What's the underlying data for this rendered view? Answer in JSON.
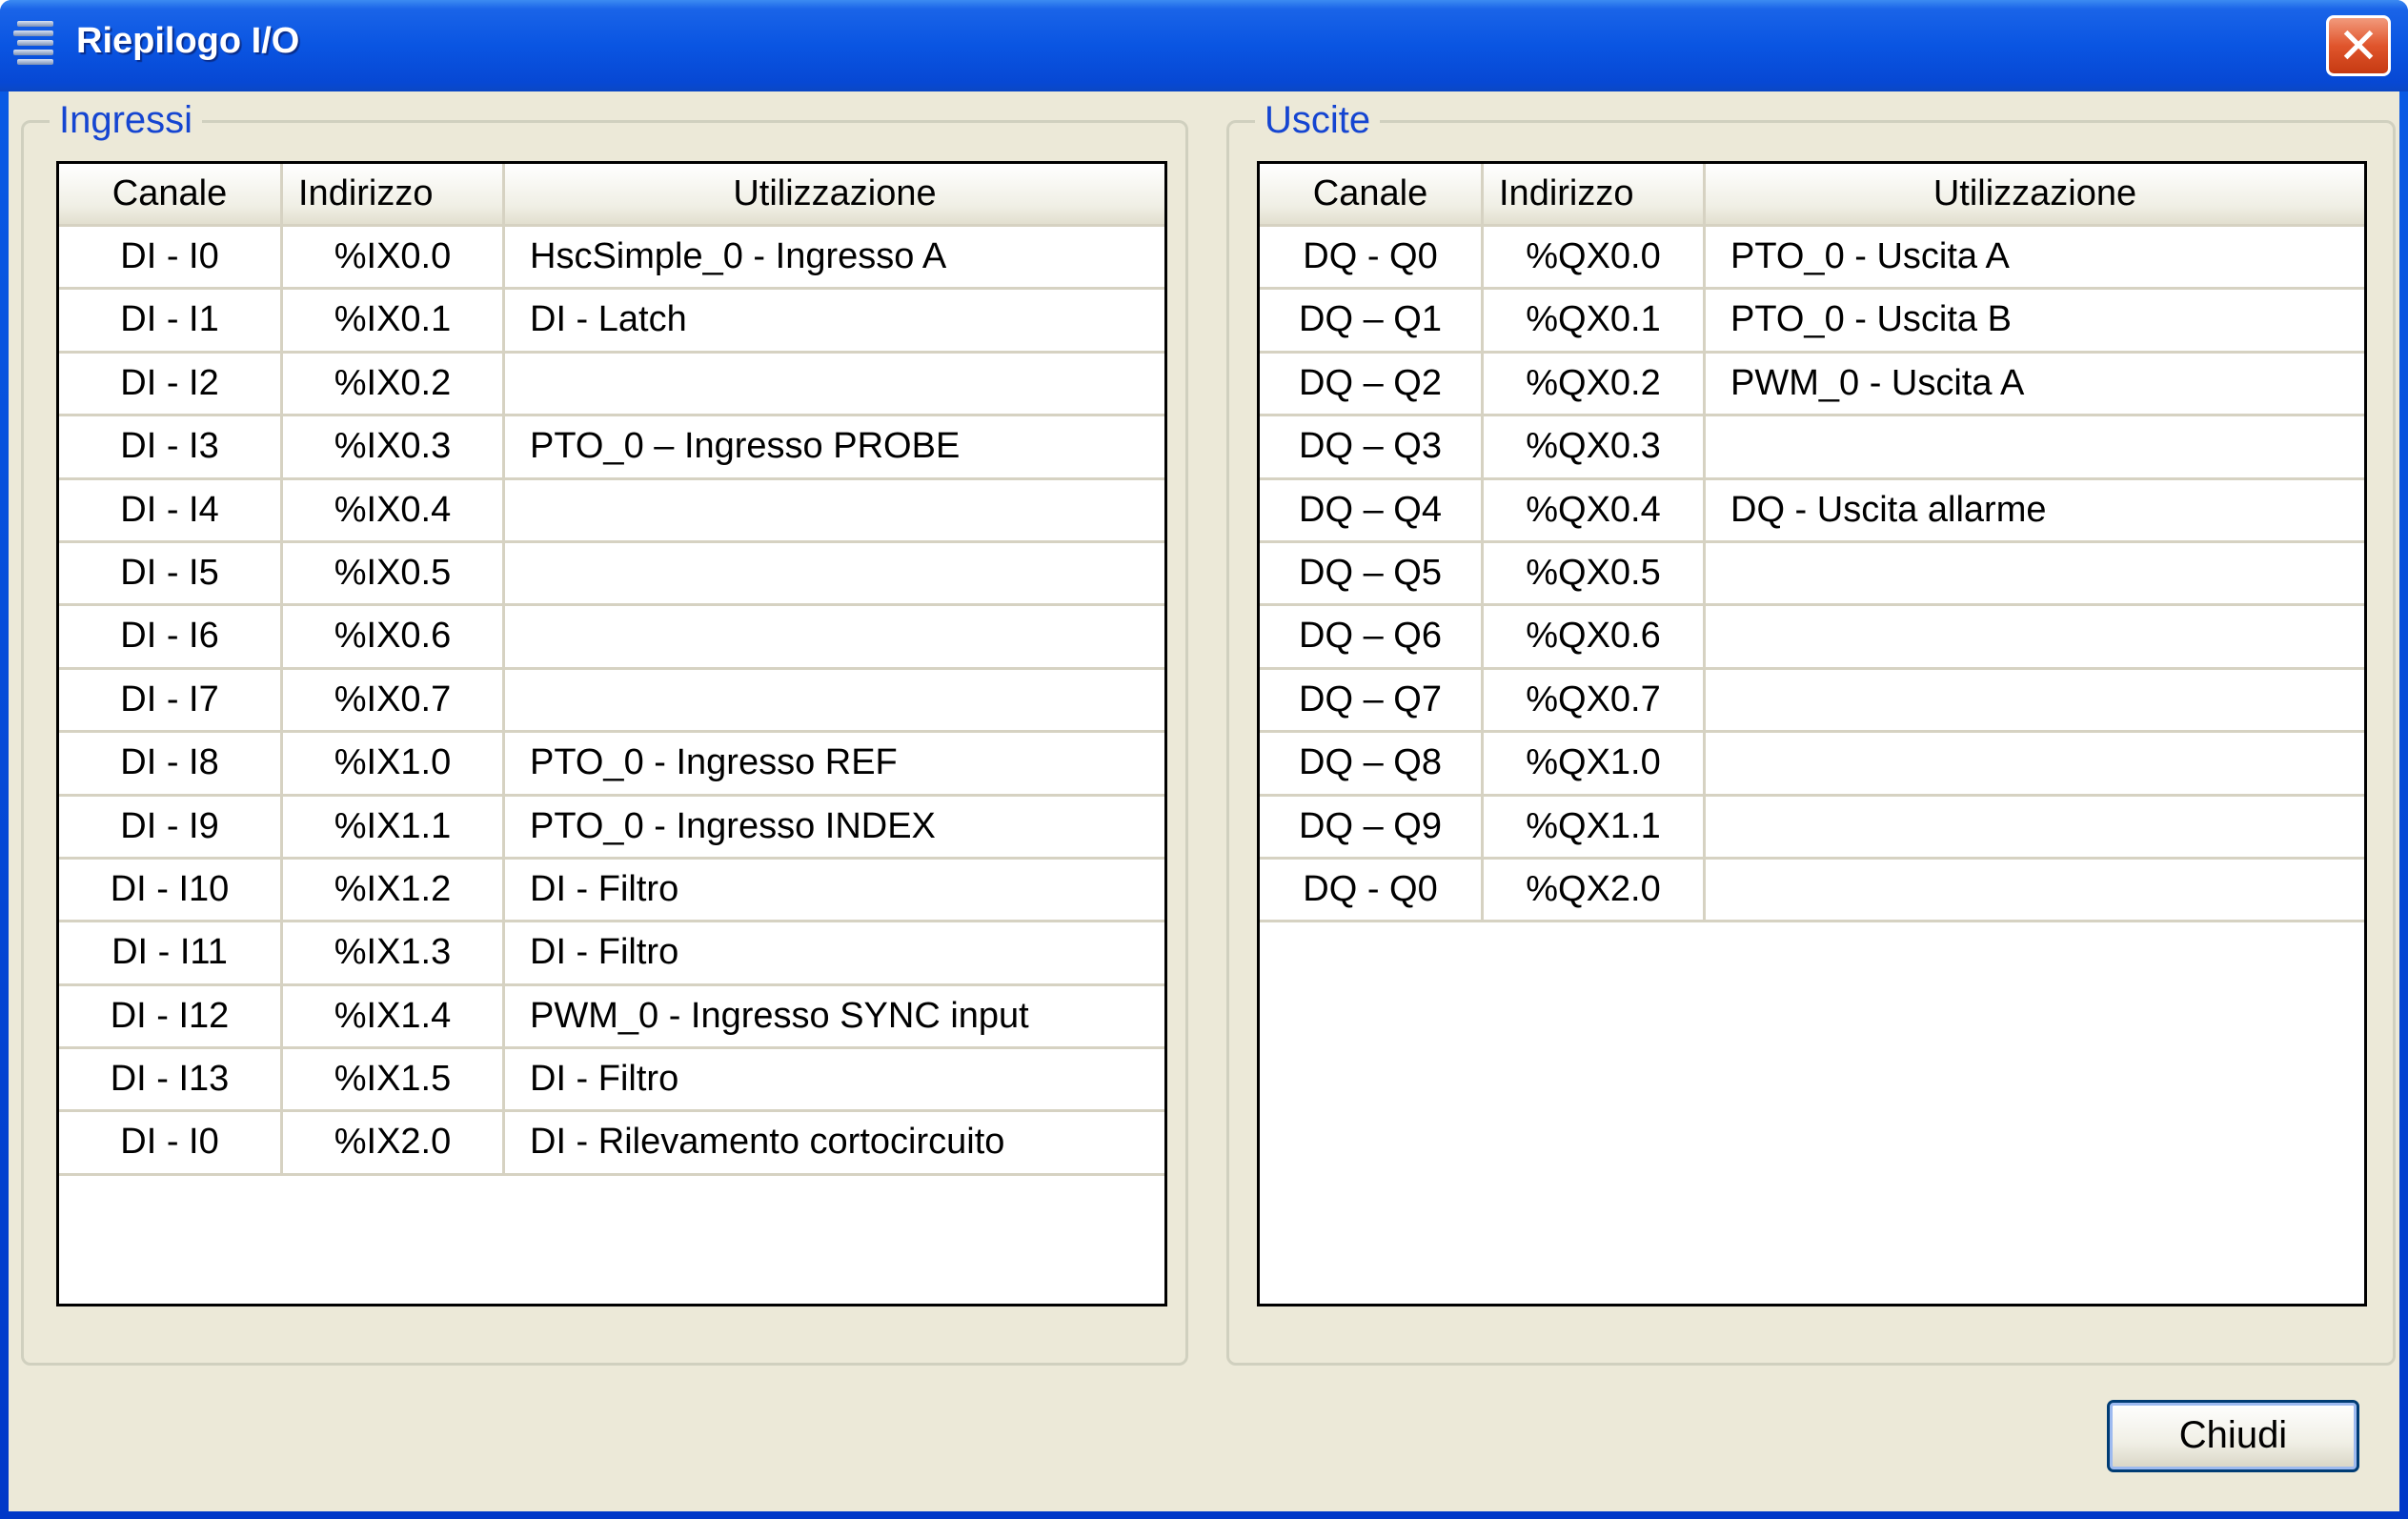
{
  "window": {
    "title": "Riepilogo I/O"
  },
  "inputs": {
    "legend": "Ingressi",
    "headers": [
      "Canale",
      "Indirizzo",
      "Utilizzazione"
    ],
    "rows": [
      [
        "DI - I0",
        "%IX0.0",
        "HscSimple_0 - Ingresso A"
      ],
      [
        "DI - I1",
        "%IX0.1",
        "DI - Latch"
      ],
      [
        "DI - I2",
        "%IX0.2",
        ""
      ],
      [
        "DI - I3",
        "%IX0.3",
        "PTO_0 – Ingresso PROBE"
      ],
      [
        "DI - I4",
        "%IX0.4",
        ""
      ],
      [
        "DI - I5",
        "%IX0.5",
        ""
      ],
      [
        "DI - I6",
        "%IX0.6",
        ""
      ],
      [
        "DI - I7",
        "%IX0.7",
        ""
      ],
      [
        "DI - I8",
        "%IX1.0",
        "PTO_0 - Ingresso REF"
      ],
      [
        "DI - I9",
        "%IX1.1",
        "PTO_0 - Ingresso INDEX"
      ],
      [
        "DI - I10",
        "%IX1.2",
        "DI - Filtro"
      ],
      [
        "DI - I11",
        "%IX1.3",
        "DI - Filtro"
      ],
      [
        "DI - I12",
        "%IX1.4",
        "PWM_0 - Ingresso SYNC input"
      ],
      [
        "DI - I13",
        "%IX1.5",
        "DI - Filtro"
      ],
      [
        "DI - I0",
        "%IX2.0",
        "DI - Rilevamento cortocircuito"
      ]
    ]
  },
  "outputs": {
    "legend": "Uscite",
    "headers": [
      "Canale",
      "Indirizzo",
      "Utilizzazione"
    ],
    "rows": [
      [
        "DQ - Q0",
        "%QX0.0",
        "PTO_0 - Uscita A"
      ],
      [
        "DQ – Q1",
        "%QX0.1",
        "PTO_0 - Uscita B"
      ],
      [
        "DQ – Q2",
        "%QX0.2",
        "PWM_0 - Uscita A"
      ],
      [
        "DQ – Q3",
        "%QX0.3",
        ""
      ],
      [
        "DQ – Q4",
        "%QX0.4",
        "DQ - Uscita allarme"
      ],
      [
        "DQ – Q5",
        "%QX0.5",
        ""
      ],
      [
        "DQ – Q6",
        "%QX0.6",
        ""
      ],
      [
        "DQ – Q7",
        "%QX0.7",
        ""
      ],
      [
        "DQ – Q8",
        "%QX1.0",
        ""
      ],
      [
        "DQ – Q9",
        "%QX1.1",
        ""
      ],
      [
        "DQ - Q0",
        "%QX2.0",
        ""
      ]
    ]
  },
  "buttons": {
    "close_label": "Chiudi"
  },
  "icons": {
    "app": "list-icon",
    "close": "close-icon"
  },
  "colors": {
    "titlebar": "#0a55e2",
    "legend": "#1545d1",
    "client": "#ece9d8",
    "close_button": "#e0552c"
  }
}
